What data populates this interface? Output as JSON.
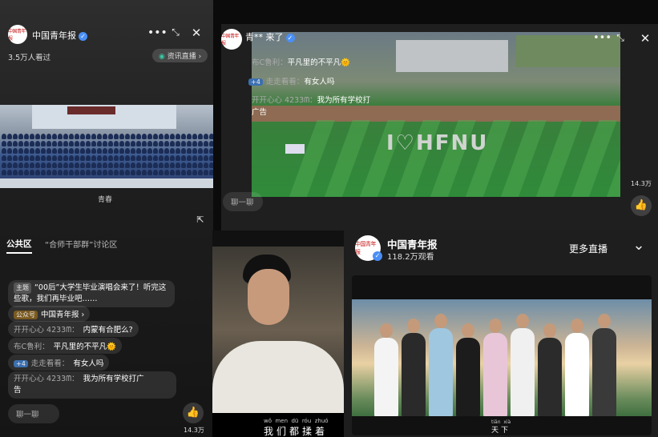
{
  "panel1": {
    "channel_name": "中国青年报",
    "viewers": "3.5万人看过",
    "news_live_label": "资讯直播",
    "caption": "青春",
    "tabs": [
      "公共区",
      "“合师干部群”讨论区"
    ],
    "comments": [
      {
        "tag": "主题",
        "text": "“00后”大学生毕业演唱会来了！听完这",
        "text2": "些歌，我们再毕业吧……"
      },
      {
        "tag": "公众号",
        "text": "中国青年报",
        "arrow": "›"
      },
      {
        "user": "开开心心 4233ᗰ：",
        "text": "内蒙有合肥么?"
      },
      {
        "user": "布C鲁利：",
        "text": "平凡里的不平凡🌞"
      },
      {
        "badge": "+4",
        "user": "走走看看：",
        "text": "有女人吗"
      },
      {
        "user": "开开心心 4233ᗰ：",
        "text": "我为所有学校打广",
        "text2": "告"
      }
    ],
    "chat_placeholder": "聊一聊",
    "likes": "14.3万"
  },
  "panel2": {
    "channel_name": "青** 来了",
    "comments": [
      {
        "user": "布C鲁利：",
        "text": "平凡里的不平凡🌞"
      },
      {
        "badge": "+4",
        "user": "走走看看：",
        "text": "有女人吗"
      },
      {
        "user": "开开心心 4233ᗰ：",
        "text": "我为所有学校打",
        "text2": "广告"
      }
    ],
    "field_text": "I♡HFNU",
    "chat_placeholder": "聊一聊",
    "likes": "14.3万"
  },
  "panel3": {
    "pinyin": [
      "wǒ",
      "men",
      "dū",
      "róu",
      "zhuó"
    ],
    "lyrics": [
      "我",
      "们",
      "都",
      "揉",
      "着"
    ]
  },
  "panel4": {
    "channel_name": "中国青年报",
    "viewers": "118.2万观看",
    "more_live": "更多直播",
    "pinyin": [
      "tiān",
      "xià"
    ],
    "lyrics": "天下"
  },
  "avatar_text": "中国青年报",
  "colors": {
    "accent": "#4a8ff7",
    "avatar_red": "#c81e1e"
  }
}
